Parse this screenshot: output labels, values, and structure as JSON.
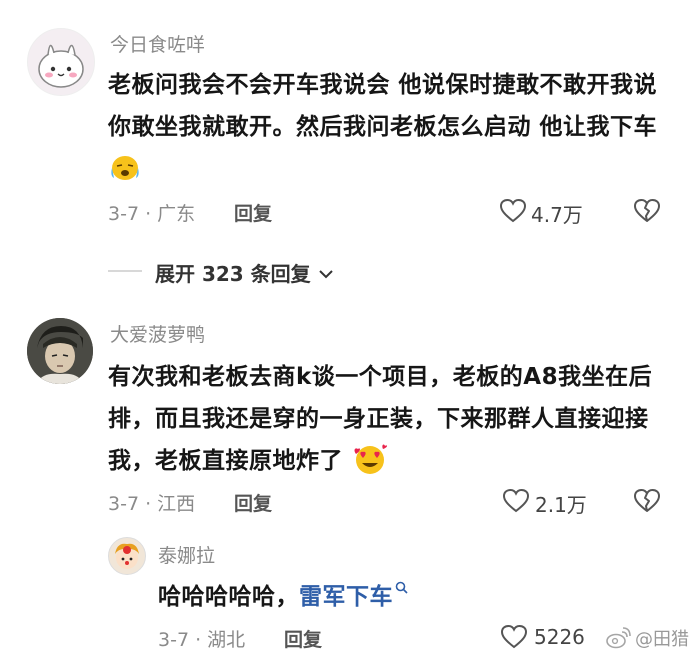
{
  "comments": [
    {
      "username": "今日食咗咩",
      "content": "老板问我会不会开车我说会 他说保时捷敢不敢开我说你敢坐我就敢开。然后我问老板怎么启动 他让我下车",
      "emoji": "crying-face-emoji",
      "date_location": "3-7 · 广东",
      "reply_label": "回复",
      "like_count": "4.7万",
      "expand_label": "展开 323 条回复"
    },
    {
      "username": "大爱菠萝鸭",
      "content": "有次我和老板去商k谈一个项目，老板的A8我坐在后排，而且我还是穿的一身正装，下来那群人直接迎接我，老板直接原地炸了",
      "emoji": "heart-eyes-emoji",
      "date_location": "3-7 · 江西",
      "reply_label": "回复",
      "like_count": "2.1万"
    },
    {
      "username": "泰娜拉",
      "content_prefix": "哈哈哈哈哈，",
      "content_link": "雷军下车",
      "date_location": "3-7 · 湖北",
      "reply_label": "回复",
      "like_count": "5226"
    }
  ],
  "watermark": "@田猎",
  "colors": {
    "link": "#2e5ea8",
    "meta": "#8a8a8a",
    "text": "#161616"
  }
}
